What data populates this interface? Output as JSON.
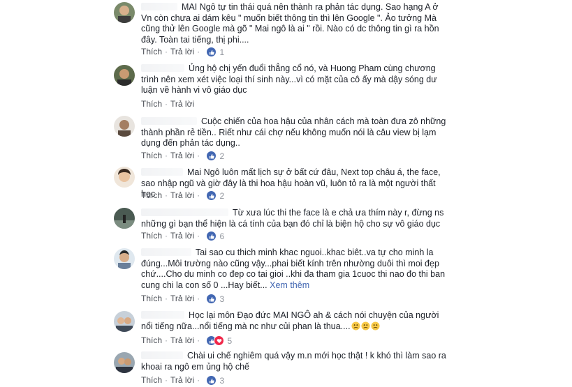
{
  "actions": {
    "like": "Thích",
    "reply": "Trả lời",
    "separator": "·"
  },
  "comments": [
    {
      "text": "MAI Ngô tự tin thái quá nên thành ra phản tác dụng. Sao hạng A ở Vn còn chưa ai dám kêu \" muốn biết thông tin thì lên Google \". Ảo tưởng Mà cũng thử lên Google mà gõ \" Mai ngô là ai \" rồi. Nào có dc thông tin gì ra hồn đây. Toàn tai tiếng, thị phi....",
      "reactions": [
        "like"
      ],
      "count": "1"
    },
    {
      "text": "Ủng hộ chị yến đuổi thẳng cổ nó, và Huong Pham cùng chương trình nên xem xét việc loại thí sinh này...vì có mặt của cô ấy mà dậy sóng dư luận về hành vi vô giáo dục",
      "reactions": [],
      "count": ""
    },
    {
      "text": "Cuộc chiến của hoa hậu của nhân cách mà toàn đưa zô những thành phần rẻ tiền.. Riết như cái chợ nếu không muốn nói là câu view bị lạm dụng đến phản tác dụng..",
      "reactions": [
        "like"
      ],
      "count": "2"
    },
    {
      "text": "Mai Ngô luôn mất lịch sự ở bất cứ đâu, Next top châu á, the face, sao nhập ngũ và giờ đây là thi hoa hậu hoàn vũ, luôn tỏ ra là một người thất học",
      "reactions": [
        "like"
      ],
      "count": "2"
    },
    {
      "text": "Từ xưa lúc thi the face là e chả ưa thím này r, đừng ns những gì bạn thể hiện là cá tính của bạn đó chỉ là biện hộ cho sự vô giáo dục",
      "reactions": [
        "like"
      ],
      "count": "6"
    },
    {
      "text": "Tai sao cu thich minh khac nguoi..khac biêt..va tự cho minh la đúng...Môi trường nào cũng vậy...phai biết kính trên nhường duôi thì moi đẹp chứ....Cho du minh co đep co tai gioi ..khi đa tham gia 1cuoc thi nao đo thi ban cung chi la con số 0 ...Hay biết...",
      "see_more": "Xem thêm",
      "reactions": [
        "like"
      ],
      "count": "3"
    },
    {
      "text": "Học lại môn Đạo đức MAI NGÔ ah & cách nói chuyện của người nổi tiếng nữa...nổi tiếng mà nc như củi phan là thua....",
      "emojis": [
        "thinking-emoji",
        "thinking-emoji",
        "thinking-emoji"
      ],
      "reactions": [
        "like",
        "love"
      ],
      "count": "5"
    },
    {
      "text": "Chài ui chế nghiêm quá vậy m.n mới học thật ! k khó thì làm sao ra khoai ra ngô em ủng hộ chế",
      "reactions": [
        "like"
      ],
      "count": "3"
    }
  ]
}
